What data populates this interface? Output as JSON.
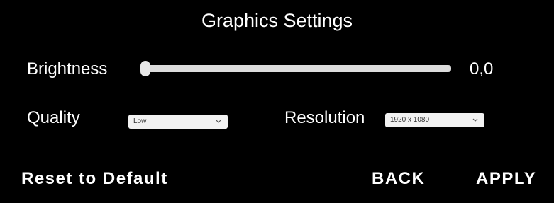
{
  "title": "Graphics Settings",
  "brightness": {
    "label": "Brightness",
    "value_text": "0,0",
    "level": 0.0
  },
  "quality": {
    "label": "Quality",
    "selected": "Low"
  },
  "resolution": {
    "label": "Resolution",
    "selected": "1920 x 1080"
  },
  "footer": {
    "reset_label": "Reset to Default",
    "back_label": "BACK",
    "apply_label": "APPLY"
  },
  "icons": {
    "dropdown_arrow": "chevron-down-icon"
  },
  "colors": {
    "background": "#000000",
    "text": "#ffffff",
    "control": "#f2f2f2"
  }
}
